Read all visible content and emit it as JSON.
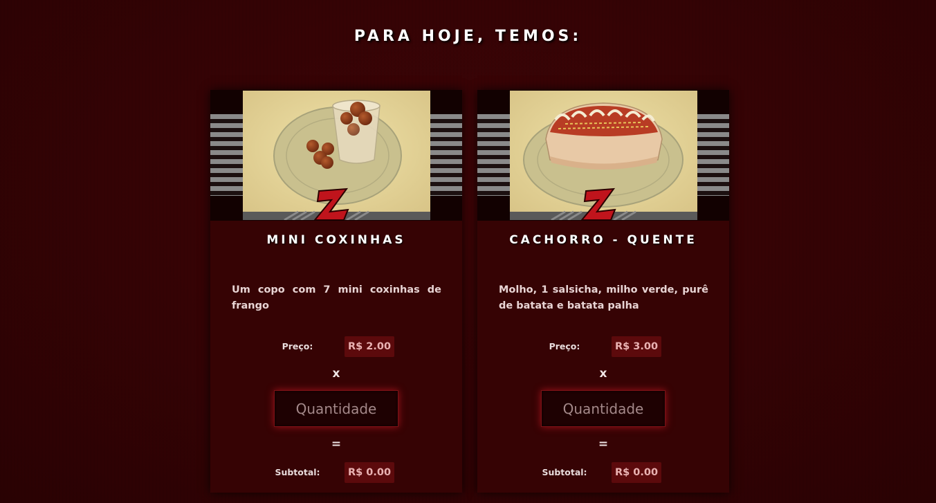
{
  "page": {
    "heading": "PARA HOJE, TEMOS:",
    "colors": {
      "background": "#350304",
      "card": "#360304",
      "price_box": "#5c0a0c",
      "input_glow": "#a0121a"
    }
  },
  "products": [
    {
      "title": "MINI COXINHAS",
      "image_subject": "mini coxinhas photo",
      "description": "Um copo com 7 mini coxinhas de frango",
      "price_label": "Preço:",
      "price_value": "R$ 2.00",
      "multiply_sign": "x",
      "quantity_placeholder": "Quantidade",
      "equals_sign": "=",
      "subtotal_label": "Subtotal:",
      "subtotal_value": "R$ 0.00"
    },
    {
      "title": "CACHORRO - QUENTE",
      "image_subject": "cachorro-quente photo",
      "description": "Molho, 1 salsicha, milho verde, purê de batata e batata palha",
      "price_label": "Preço:",
      "price_value": "R$ 3.00",
      "multiply_sign": "x",
      "quantity_placeholder": "Quantidade",
      "equals_sign": "=",
      "subtotal_label": "Subtotal:",
      "subtotal_value": "R$ 0.00"
    }
  ]
}
